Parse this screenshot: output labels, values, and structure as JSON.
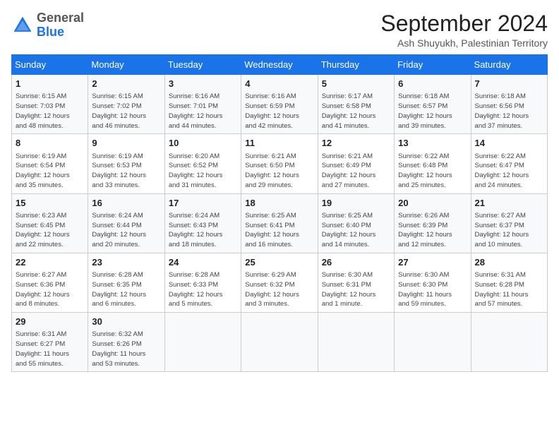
{
  "header": {
    "logo_general": "General",
    "logo_blue": "Blue",
    "title": "September 2024",
    "location": "Ash Shuyukh, Palestinian Territory"
  },
  "weekdays": [
    "Sunday",
    "Monday",
    "Tuesday",
    "Wednesday",
    "Thursday",
    "Friday",
    "Saturday"
  ],
  "weeks": [
    [
      {
        "day": "1",
        "info": "Sunrise: 6:15 AM\nSunset: 7:03 PM\nDaylight: 12 hours\nand 48 minutes."
      },
      {
        "day": "2",
        "info": "Sunrise: 6:15 AM\nSunset: 7:02 PM\nDaylight: 12 hours\nand 46 minutes."
      },
      {
        "day": "3",
        "info": "Sunrise: 6:16 AM\nSunset: 7:01 PM\nDaylight: 12 hours\nand 44 minutes."
      },
      {
        "day": "4",
        "info": "Sunrise: 6:16 AM\nSunset: 6:59 PM\nDaylight: 12 hours\nand 42 minutes."
      },
      {
        "day": "5",
        "info": "Sunrise: 6:17 AM\nSunset: 6:58 PM\nDaylight: 12 hours\nand 41 minutes."
      },
      {
        "day": "6",
        "info": "Sunrise: 6:18 AM\nSunset: 6:57 PM\nDaylight: 12 hours\nand 39 minutes."
      },
      {
        "day": "7",
        "info": "Sunrise: 6:18 AM\nSunset: 6:56 PM\nDaylight: 12 hours\nand 37 minutes."
      }
    ],
    [
      {
        "day": "8",
        "info": "Sunrise: 6:19 AM\nSunset: 6:54 PM\nDaylight: 12 hours\nand 35 minutes."
      },
      {
        "day": "9",
        "info": "Sunrise: 6:19 AM\nSunset: 6:53 PM\nDaylight: 12 hours\nand 33 minutes."
      },
      {
        "day": "10",
        "info": "Sunrise: 6:20 AM\nSunset: 6:52 PM\nDaylight: 12 hours\nand 31 minutes."
      },
      {
        "day": "11",
        "info": "Sunrise: 6:21 AM\nSunset: 6:50 PM\nDaylight: 12 hours\nand 29 minutes."
      },
      {
        "day": "12",
        "info": "Sunrise: 6:21 AM\nSunset: 6:49 PM\nDaylight: 12 hours\nand 27 minutes."
      },
      {
        "day": "13",
        "info": "Sunrise: 6:22 AM\nSunset: 6:48 PM\nDaylight: 12 hours\nand 25 minutes."
      },
      {
        "day": "14",
        "info": "Sunrise: 6:22 AM\nSunset: 6:47 PM\nDaylight: 12 hours\nand 24 minutes."
      }
    ],
    [
      {
        "day": "15",
        "info": "Sunrise: 6:23 AM\nSunset: 6:45 PM\nDaylight: 12 hours\nand 22 minutes."
      },
      {
        "day": "16",
        "info": "Sunrise: 6:24 AM\nSunset: 6:44 PM\nDaylight: 12 hours\nand 20 minutes."
      },
      {
        "day": "17",
        "info": "Sunrise: 6:24 AM\nSunset: 6:43 PM\nDaylight: 12 hours\nand 18 minutes."
      },
      {
        "day": "18",
        "info": "Sunrise: 6:25 AM\nSunset: 6:41 PM\nDaylight: 12 hours\nand 16 minutes."
      },
      {
        "day": "19",
        "info": "Sunrise: 6:25 AM\nSunset: 6:40 PM\nDaylight: 12 hours\nand 14 minutes."
      },
      {
        "day": "20",
        "info": "Sunrise: 6:26 AM\nSunset: 6:39 PM\nDaylight: 12 hours\nand 12 minutes."
      },
      {
        "day": "21",
        "info": "Sunrise: 6:27 AM\nSunset: 6:37 PM\nDaylight: 12 hours\nand 10 minutes."
      }
    ],
    [
      {
        "day": "22",
        "info": "Sunrise: 6:27 AM\nSunset: 6:36 PM\nDaylight: 12 hours\nand 8 minutes."
      },
      {
        "day": "23",
        "info": "Sunrise: 6:28 AM\nSunset: 6:35 PM\nDaylight: 12 hours\nand 6 minutes."
      },
      {
        "day": "24",
        "info": "Sunrise: 6:28 AM\nSunset: 6:33 PM\nDaylight: 12 hours\nand 5 minutes."
      },
      {
        "day": "25",
        "info": "Sunrise: 6:29 AM\nSunset: 6:32 PM\nDaylight: 12 hours\nand 3 minutes."
      },
      {
        "day": "26",
        "info": "Sunrise: 6:30 AM\nSunset: 6:31 PM\nDaylight: 12 hours\nand 1 minute."
      },
      {
        "day": "27",
        "info": "Sunrise: 6:30 AM\nSunset: 6:30 PM\nDaylight: 11 hours\nand 59 minutes."
      },
      {
        "day": "28",
        "info": "Sunrise: 6:31 AM\nSunset: 6:28 PM\nDaylight: 11 hours\nand 57 minutes."
      }
    ],
    [
      {
        "day": "29",
        "info": "Sunrise: 6:31 AM\nSunset: 6:27 PM\nDaylight: 11 hours\nand 55 minutes."
      },
      {
        "day": "30",
        "info": "Sunrise: 6:32 AM\nSunset: 6:26 PM\nDaylight: 11 hours\nand 53 minutes."
      },
      null,
      null,
      null,
      null,
      null
    ]
  ]
}
